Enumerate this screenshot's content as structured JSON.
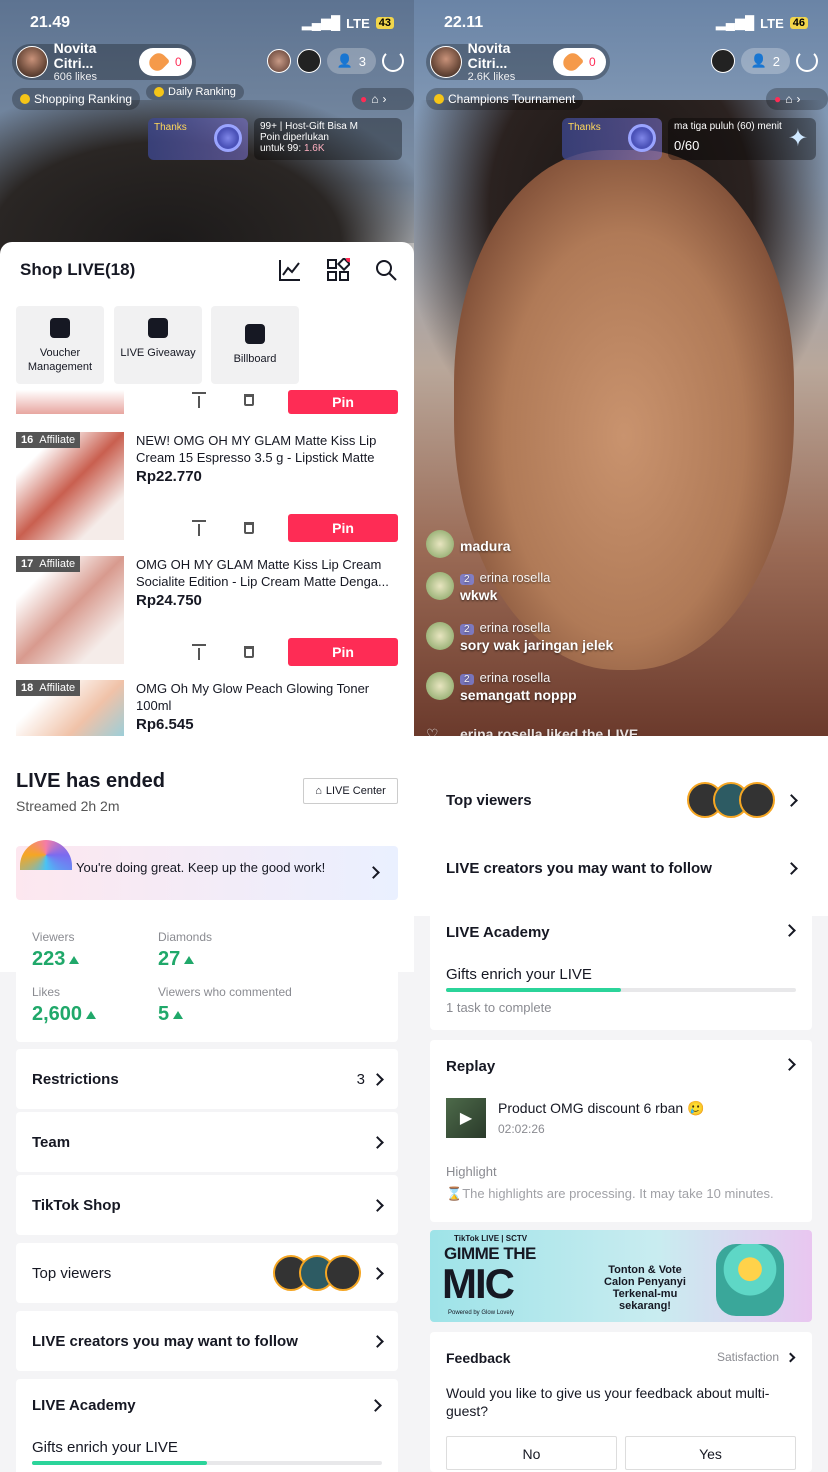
{
  "left_live": {
    "time": "21.49",
    "network": "LTE",
    "battery": "43",
    "host_name": "Novita Citri...",
    "host_likes": "606 likes",
    "like_count": "0",
    "viewer_count": "3",
    "ranking_pill": "Shopping Ranking",
    "daily_pill": "Daily Ranking",
    "thanks_label": "Thanks",
    "gift_line1": "99+ | Host-Gift Bisa M",
    "gift_line2": "Poin diperlukan",
    "gift_line3": "untuk 99:",
    "gift_points": "1.6K"
  },
  "shop": {
    "title": "Shop LIVE(18)",
    "tools": [
      {
        "label": "Voucher Management",
        "icon": "ticket-icon"
      },
      {
        "label": "LIVE Giveaway",
        "icon": "gift-bag-icon"
      },
      {
        "label": "Billboard",
        "icon": "briefcase-icon"
      }
    ],
    "pin_label": "Pin",
    "products": [
      {
        "num": "16",
        "tag": "Affiliate",
        "title": "NEW! OMG OH MY GLAM Matte Kiss Lip Cream 15 Espresso 3.5 g - Lipstick Matte",
        "price": "Rp22.770"
      },
      {
        "num": "17",
        "tag": "Affiliate",
        "title": "OMG OH MY GLAM Matte Kiss Lip Cream Socialite Edition - Lip Cream Matte Denga...",
        "price": "Rp24.750"
      },
      {
        "num": "18",
        "tag": "Affiliate",
        "title": "OMG Oh My Glow Peach Glowing Toner 100ml",
        "price": "Rp6.545"
      }
    ]
  },
  "right_live": {
    "time": "22.11",
    "network": "LTE",
    "battery": "46",
    "host_name": "Novita Citri...",
    "host_likes": "2.6K likes",
    "like_count": "0",
    "viewer_count": "2",
    "tournament_pill": "Champions Tournament",
    "thanks_label": "Thanks",
    "goal_text": "ma tiga puluh (60) menit",
    "goal_value": "0/60",
    "comments": [
      {
        "user": "",
        "level": "",
        "text": "madura"
      },
      {
        "user": "erina rosella",
        "level": "2",
        "text": "wkwk"
      },
      {
        "user": "erina rosella",
        "level": "2",
        "text": "sory wak jaringan jelek"
      },
      {
        "user": "erina rosella",
        "level": "2",
        "text": "semangatt noppp"
      }
    ],
    "liked_text": "erina rosella liked the LIVE"
  },
  "ended": {
    "title": "LIVE has ended",
    "duration": "Streamed 2h 2m",
    "center_btn": "LIVE Center",
    "banner": "You're doing great. Keep up the good work!",
    "stats": [
      {
        "label": "Viewers",
        "value": "223"
      },
      {
        "label": "Diamonds",
        "value": "27"
      },
      {
        "label": "Likes",
        "value": "2,600"
      },
      {
        "label": "Viewers who commented",
        "value": "5"
      }
    ],
    "restrictions": "Restrictions",
    "restrictions_count": "3",
    "team": "Team",
    "tiktok_shop": "TikTok Shop",
    "top_viewers": "Top viewers",
    "creators": "LIVE creators you may want to follow",
    "academy": "LIVE Academy",
    "academy_task": "Gifts enrich your LIVE",
    "academy_progress": 0.5
  },
  "summary2": {
    "top_viewers": "Top viewers",
    "creators": "LIVE creators you may want to follow",
    "academy": "LIVE Academy",
    "academy_task": "Gifts enrich your LIVE",
    "academy_sub": "1 task to complete",
    "academy_progress": 0.5,
    "replay": "Replay",
    "replay_title": "Product OMG discount 6 rban 🥲",
    "replay_time": "02:02:26",
    "highlight": "Highlight",
    "highlight_note": "The highlights are processing. It may take 10 minutes.",
    "ad_brand": "TikTok LIVE | SCTV",
    "ad_title1": "GIMME THE",
    "ad_title2": "MIC",
    "ad_line1": "Tonton & Vote",
    "ad_line2": "Calon Penyanyi",
    "ad_line3": "Terkenal-mu sekarang!",
    "ad_powered": "Powered by Glow Lovely",
    "feedback": "Feedback",
    "satisfaction": "Satisfaction",
    "feedback_q": "Would you like to give us your feedback about multi-guest?",
    "no": "No",
    "yes": "Yes"
  }
}
